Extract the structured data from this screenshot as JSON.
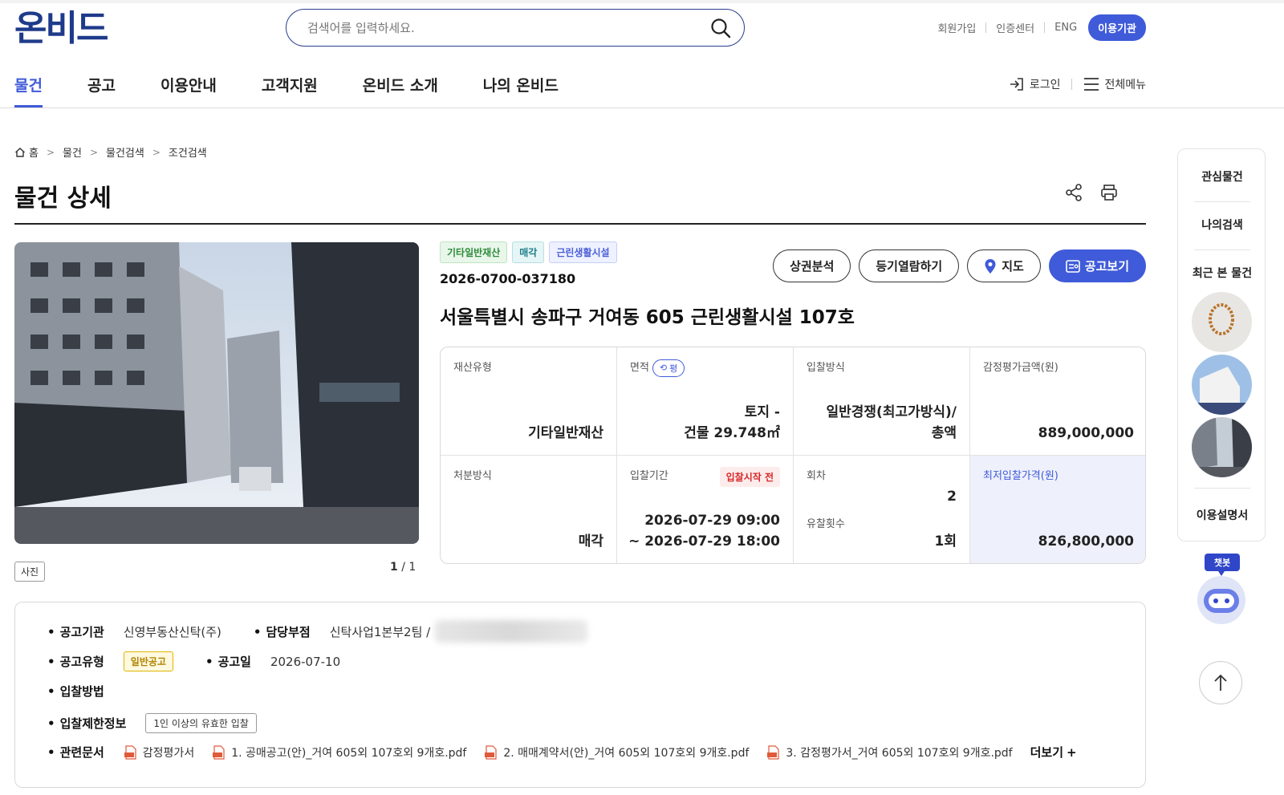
{
  "header": {
    "logo": "온비드",
    "search_placeholder": "검색어를 입력하세요.",
    "util_links": [
      "회원가입",
      "인증센터",
      "ENG"
    ],
    "util_active": "이용기관"
  },
  "gnb": {
    "items": [
      "물건",
      "공고",
      "이용안내",
      "고객지원",
      "온비드 소개",
      "나의 온비드"
    ],
    "login": "로그인",
    "all_menu": "전체메뉴"
  },
  "breadcrumb": [
    "홈",
    "물건",
    "물건검색",
    "조건검색"
  ],
  "page_title": "물건 상세",
  "photo": {
    "tag": "사진",
    "current": "1",
    "total": "/ 1"
  },
  "item": {
    "tags": [
      "기타일반재산",
      "매각",
      "근린생활시설"
    ],
    "number": "2026-0700-037180",
    "title": "서울특별시 송파구 거여동 605 근린생활시설 107호"
  },
  "actions": [
    "상권분석",
    "등기열람하기",
    "지도",
    "공고보기"
  ],
  "info": {
    "asset_type_label": "재산유형",
    "asset_type": "기타일반재산",
    "area_label": "면적",
    "area_unit_toggle": "평",
    "area_line1": "토지 -",
    "area_line2": "건물 29.748㎡",
    "bid_method_label": "입찰방식",
    "bid_method_line1": "일반경쟁(최고가방식)/",
    "bid_method_line2": "총액",
    "appraisal_label": "감정평가금액(원)",
    "appraisal": "889,000,000",
    "disposal_label": "처분방식",
    "disposal": "매각",
    "period_label": "입찰기간",
    "period_status": "입찰시작 전",
    "period_start": "2026-07-29 09:00",
    "period_end": "~ 2026-07-29 18:00",
    "round_label": "회차",
    "round": "2",
    "failed_label": "유찰횟수",
    "failed": "1회",
    "min_bid_label": "최저입찰가격(원)",
    "min_bid": "826,800,000"
  },
  "detail": {
    "agency_label": "공고기관",
    "agency": "신영부동산신탁(주)",
    "branch_label": "담당부점",
    "branch": "신탁사업1본부2팀 /",
    "notice_type_label": "공고유형",
    "notice_type": "일반공고",
    "notice_date_label": "공고일",
    "notice_date": "2026-07-10",
    "bid_way_label": "입찰방법",
    "restrict_label": "입찰제한정보",
    "restrict": "1인 이상의 유효한 입찰",
    "docs_label": "관련문서",
    "docs": [
      "감정평가서",
      "1. 공매공고(안)_거여 605외 107호외 9개호.pdf",
      "2. 매매계약서(안)_거여 605외 107호외 9개호.pdf",
      "3. 감정평가서_거여 605외 107호외 9개호.pdf"
    ],
    "more": "더보기"
  },
  "quick": {
    "items": [
      "관심물건",
      "나의검색",
      "최근 본 물건",
      "이용설명서"
    ],
    "chatbot": "챗봇"
  }
}
